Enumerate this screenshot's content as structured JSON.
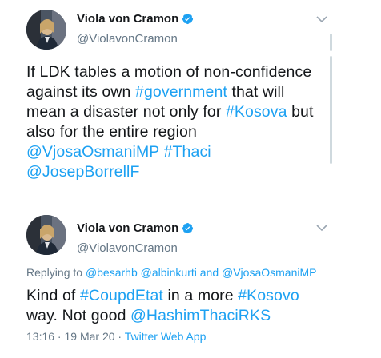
{
  "tweets": [
    {
      "author_name": "Viola von Cramon",
      "handle": "@ViolavonCramon",
      "body": [
        {
          "text": "If LDK tables a motion of non-confidence against its own ",
          "link": false
        },
        {
          "text": "#government",
          "link": true
        },
        {
          "text": " that will mean a disaster not only for ",
          "link": false
        },
        {
          "text": "#Kosova",
          "link": true
        },
        {
          "text": " but also for the entire region ",
          "link": false
        },
        {
          "text": "@VjosaOsmaniMP",
          "link": true
        },
        {
          "text": " ",
          "link": false
        },
        {
          "text": "#Thaci",
          "link": true
        },
        {
          "text": " ",
          "link": false
        },
        {
          "text": "@JosepBorrellF",
          "link": true
        }
      ]
    },
    {
      "author_name": "Viola von Cramon",
      "handle": "@ViolavonCramon",
      "replying_to": {
        "prefix": "Replying to ",
        "users": "@besarhb @albinkurti and @VjosaOsmaniMP"
      },
      "body": [
        {
          "text": "Kind of ",
          "link": false
        },
        {
          "text": "#CoupdEtat",
          "link": true
        },
        {
          "text": " in a more ",
          "link": false
        },
        {
          "text": "#Kosovo",
          "link": true
        },
        {
          "text": " way. Not good ",
          "link": false
        },
        {
          "text": "@HashimThaciRKS",
          "link": true
        }
      ],
      "timestamp": "13:16 · 19 Mar 20 · ",
      "source": "Twitter Web App"
    }
  ],
  "colors": {
    "link": "#1da1f2",
    "secondary_text": "#657786",
    "primary_text": "#14171a",
    "verified_badge": "#1da1f2"
  },
  "icons": [
    "verified-badge-icon",
    "chevron-down-icon"
  ]
}
